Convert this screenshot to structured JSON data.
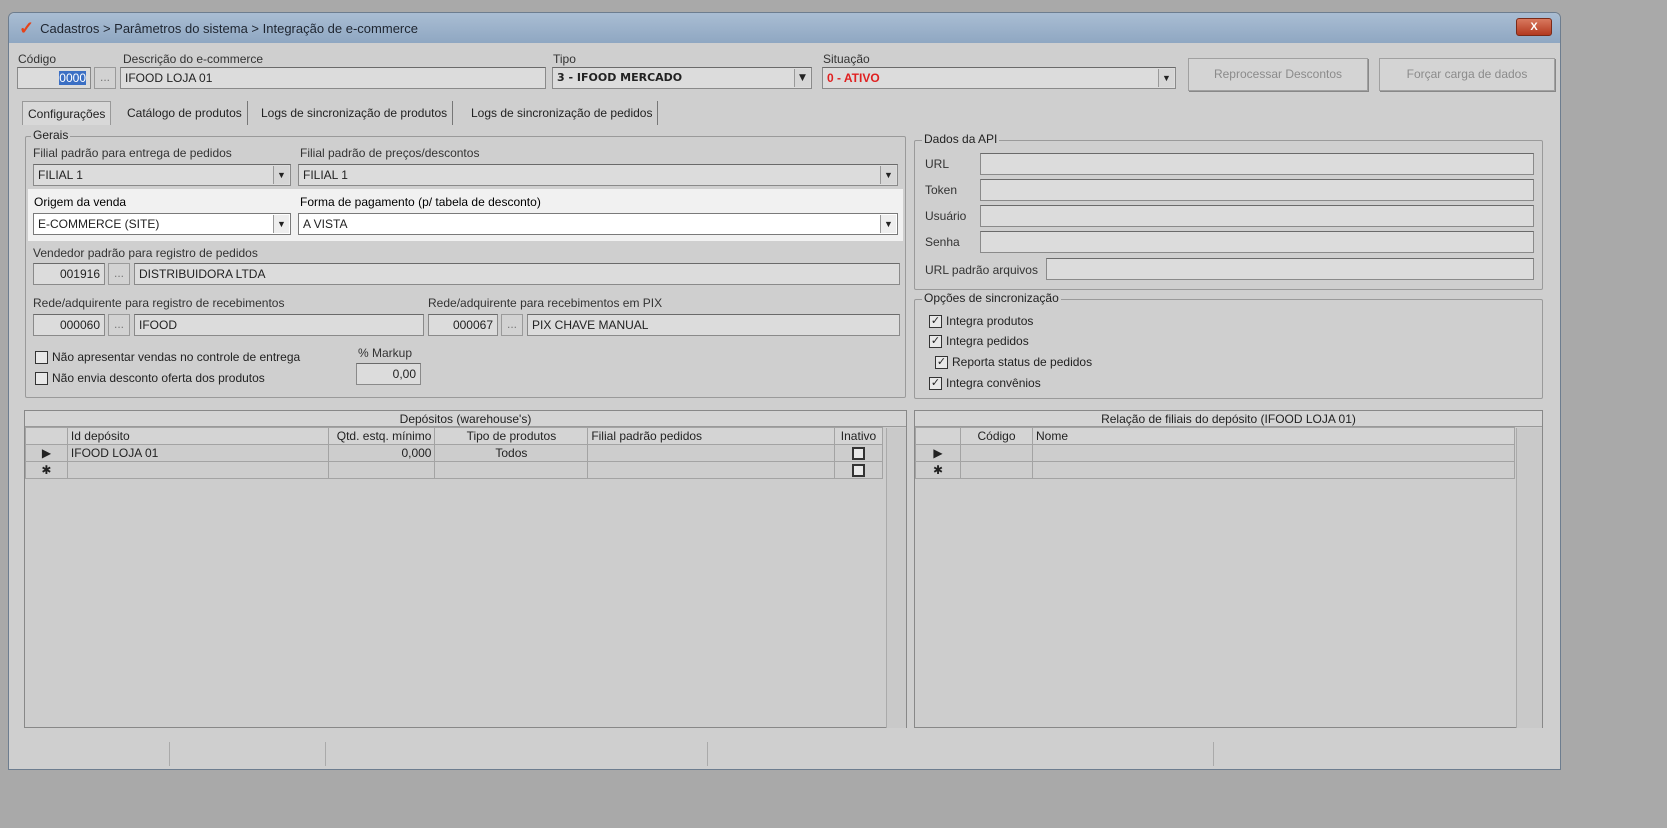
{
  "window": {
    "title": "Cadastros > Parâmetros do sistema > Integração de e-commerce",
    "close": "X"
  },
  "header": {
    "codigo_label": "Código",
    "codigo_value": "0000",
    "descricao_label": "Descrição do e-commerce",
    "descricao_value": "IFOOD LOJA 01",
    "tipo_label": "Tipo",
    "tipo_value": "3 - IFOOD MERCADO",
    "situacao_label": "Situação",
    "situacao_value": "0 - ATIVO",
    "reprocessar": "Reprocessar Descontos",
    "forcar": "Forçar carga de dados",
    "dots": "..."
  },
  "tabs": [
    "Configurações",
    "Catálogo de produtos",
    "Logs de sincronização de produtos",
    "Logs de sincronização de pedidos"
  ],
  "gerais": {
    "title": "Gerais",
    "filial_entrega_label": "Filial padrão para entrega de pedidos",
    "filial_entrega": "FILIAL 1",
    "filial_precos_label": "Filial padrão de preços/descontos",
    "filial_precos": "FILIAL 1",
    "origem_label": "Origem da venda",
    "origem": "E-COMMERCE (SITE)",
    "forma_label": "Forma de pagamento (p/ tabela de desconto)",
    "forma": "A VISTA",
    "vendedor_label": "Vendedor padrão para registro de pedidos",
    "vendedor_code": "001916",
    "vendedor_name": "DISTRIBUIDORA LTDA",
    "rede_label": "Rede/adquirente para registro de recebimentos",
    "rede_code": "000060",
    "rede_name": "IFOOD",
    "pix_label": "Rede/adquirente para recebimentos em PIX",
    "pix_code": "000067",
    "pix_name": "PIX CHAVE MANUAL",
    "chk1": "Não apresentar vendas no controle de entrega",
    "chk2": "Não envia desconto oferta dos produtos",
    "markup_label": "% Markup",
    "markup": "0,00"
  },
  "api": {
    "title": "Dados da API",
    "url": "URL",
    "token": "Token",
    "usuario": "Usuário",
    "senha": "Senha",
    "url_arquivos": "URL padrão arquivos"
  },
  "sync": {
    "title": "Opções de sincronização",
    "items": [
      "Integra produtos",
      "Integra pedidos",
      "Reporta status de pedidos",
      "Integra convênios"
    ]
  },
  "depositos": {
    "title": "Depósitos (warehouse's)",
    "cols": [
      "Id depósito",
      "Qtd. estq. mínimo",
      "Tipo de produtos",
      "Filial padrão pedidos",
      "Inativo"
    ],
    "row": {
      "id": "IFOOD LOJA 01",
      "qtd": "0,000",
      "tipo": "Todos",
      "filial": ""
    }
  },
  "filiais": {
    "title": "Relação de filiais do depósito (IFOOD LOJA 01)",
    "cols": [
      "Código",
      "Nome"
    ]
  }
}
